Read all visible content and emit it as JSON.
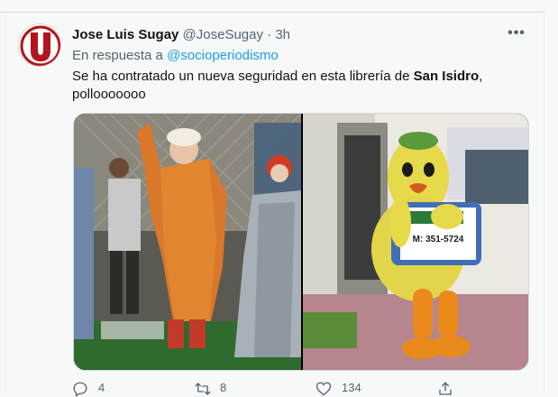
{
  "tweet": {
    "display_name": "Jose Luis Sugay",
    "handle": "@JoseSugay",
    "separator": "·",
    "time": "3h",
    "reply_prefix": "En respuesta a",
    "reply_to": "@socioperiodismo",
    "text_part1": "Se ha contratado un nueva seguridad en esta librería de ",
    "text_bold": "San Isidro",
    "text_part2": ",",
    "text_line2": "pollooooooo",
    "more_label": "•••",
    "mascot_sign": "M: 351-5724",
    "counts": {
      "reply": "4",
      "retweet": "8",
      "like": "134"
    }
  },
  "colors": {
    "accent": "#1d9bf0",
    "secondary_text": "#536471",
    "primary_text": "#0f1419",
    "background": "#f7f9f9",
    "logo_red": "#b2141c"
  },
  "icons": [
    "avatar-logo-icon",
    "more-icon",
    "reply-icon",
    "retweet-icon",
    "like-icon",
    "share-icon"
  ]
}
